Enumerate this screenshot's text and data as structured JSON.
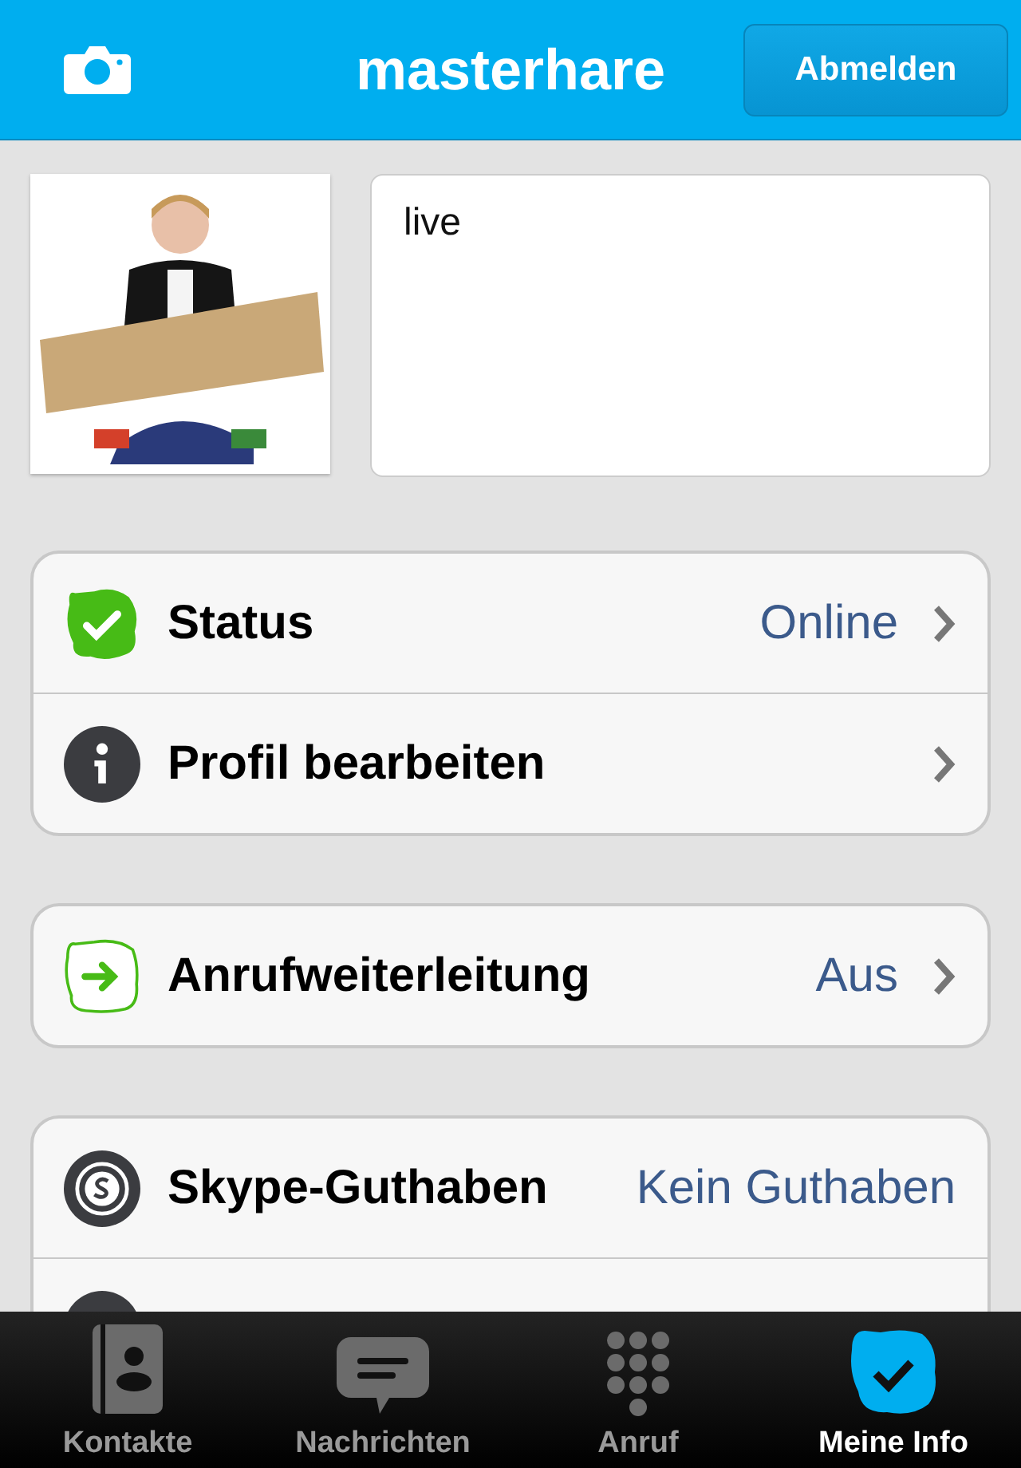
{
  "header": {
    "title": "masterhare",
    "button": "Abmelden"
  },
  "profile": {
    "mood": {
      "value": "live"
    }
  },
  "groups": [
    {
      "rows": [
        {
          "kind": "status",
          "label": "Status",
          "value": "Online"
        },
        {
          "kind": "info",
          "label": "Profil bearbeiten"
        }
      ]
    },
    {
      "rows": [
        {
          "kind": "forward",
          "label": "Anrufweiterleitung",
          "value": "Aus"
        }
      ]
    },
    {
      "rows": [
        {
          "kind": "credit",
          "label": "Skype-Guthaben",
          "value": "Kein Guthaben"
        },
        {
          "kind": "number"
        }
      ]
    }
  ],
  "tabs": [
    {
      "kind": "contacts",
      "label": "Kontakte",
      "selected": false
    },
    {
      "kind": "chat",
      "label": "Nachrichten",
      "selected": false
    },
    {
      "kind": "dialpad",
      "label": "Anruf",
      "selected": false
    },
    {
      "kind": "me",
      "label": "Meine Info",
      "selected": true
    }
  ]
}
